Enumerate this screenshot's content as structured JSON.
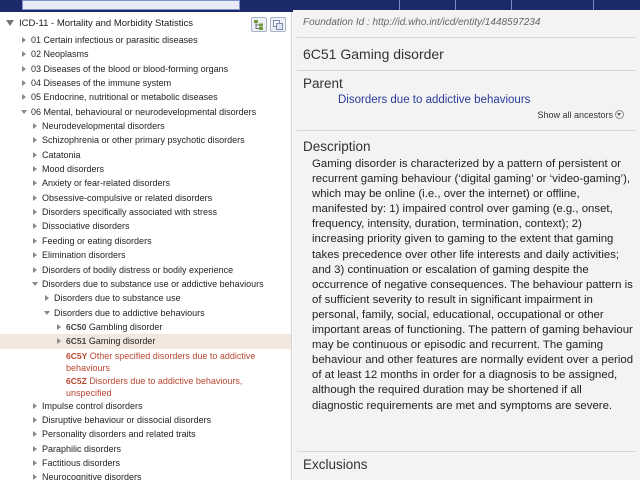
{
  "colors": {
    "navy": "#1c2a6b",
    "link": "#2a3c9a",
    "selected_row": "#f3e8df",
    "residual_red": "#b8452f"
  },
  "tree": {
    "title": "ICD-11 - Mortality and Morbidity Statistics",
    "buttons": [
      {
        "icon": "hierarchy-icon"
      },
      {
        "icon": "copy-icon"
      }
    ],
    "items": [
      {
        "code": "01",
        "label": "Certain infectious or parasitic diseases"
      },
      {
        "code": "02",
        "label": "Neoplasms"
      },
      {
        "code": "03",
        "label": "Diseases of the blood or blood-forming organs"
      },
      {
        "code": "04",
        "label": "Diseases of the immune system"
      },
      {
        "code": "05",
        "label": "Endocrine, nutritional or metabolic diseases"
      },
      {
        "code": "06",
        "label": "Mental, behavioural or neurodevelopmental disorders"
      },
      {
        "label": "Neurodevelopmental disorders"
      },
      {
        "label": "Schizophrenia or other primary psychotic disorders"
      },
      {
        "label": "Catatonia"
      },
      {
        "label": "Mood disorders"
      },
      {
        "label": "Anxiety or fear-related disorders"
      },
      {
        "label": "Obsessive-compulsive or related disorders"
      },
      {
        "label": "Disorders specifically associated with stress"
      },
      {
        "label": "Dissociative disorders"
      },
      {
        "label": "Feeding or eating disorders"
      },
      {
        "label": "Elimination disorders"
      },
      {
        "label": "Disorders of bodily distress or bodily experience"
      },
      {
        "label": "Disorders due to substance use or addictive behaviours"
      },
      {
        "label": "Disorders due to substance use"
      },
      {
        "label": "Disorders due to addictive behaviours"
      },
      {
        "code": "6C50",
        "label": "Gambling disorder"
      },
      {
        "code": "6C51",
        "label": "Gaming disorder"
      },
      {
        "code": "6C5Y",
        "label": "Other specified disorders due to addictive behaviours"
      },
      {
        "code": "6C5Z",
        "label": "Disorders due to addictive behaviours, unspecified"
      },
      {
        "label": "Impulse control disorders"
      },
      {
        "label": "Disruptive behaviour or dissocial disorders"
      },
      {
        "label": "Personality disorders and related traits"
      },
      {
        "label": "Paraphilic disorders"
      },
      {
        "label": "Factitious disorders"
      },
      {
        "label": "Neurocognitive disorders"
      }
    ]
  },
  "detail": {
    "foundation_id": "Foundation Id : http://id.who.int/icd/entity/1448597234",
    "title": "6C51 Gaming disorder",
    "parent_heading": "Parent",
    "parent_link": "Disorders due to addictive behaviours",
    "show_ancestors": "Show all ancestors",
    "description_heading": "Description",
    "description": "Gaming disorder is characterized by a pattern of persistent or recurrent gaming behaviour (‘digital gaming’ or ‘video-gaming’), which may be online (i.e., over the internet) or offline, manifested by: 1) impaired control over gaming (e.g., onset, frequency, intensity, duration, termination, context); 2) increasing priority given to gaming to the extent that gaming takes precedence over other life interests and daily activities; and 3) continuation or escalation of gaming despite the occurrence of negative consequences. The behaviour pattern is of sufficient severity to result in significant impairment in personal, family, social, educational, occupational or other important areas of functioning. The pattern of gaming behaviour may be continuous or episodic and recurrent. The gaming behaviour and other features are normally evident over a period of at least 12 months in order for a diagnosis to be assigned, although the required duration may be shortened if all diagnostic requirements are met and symptoms are severe.",
    "exclusions_heading": "Exclusions"
  }
}
